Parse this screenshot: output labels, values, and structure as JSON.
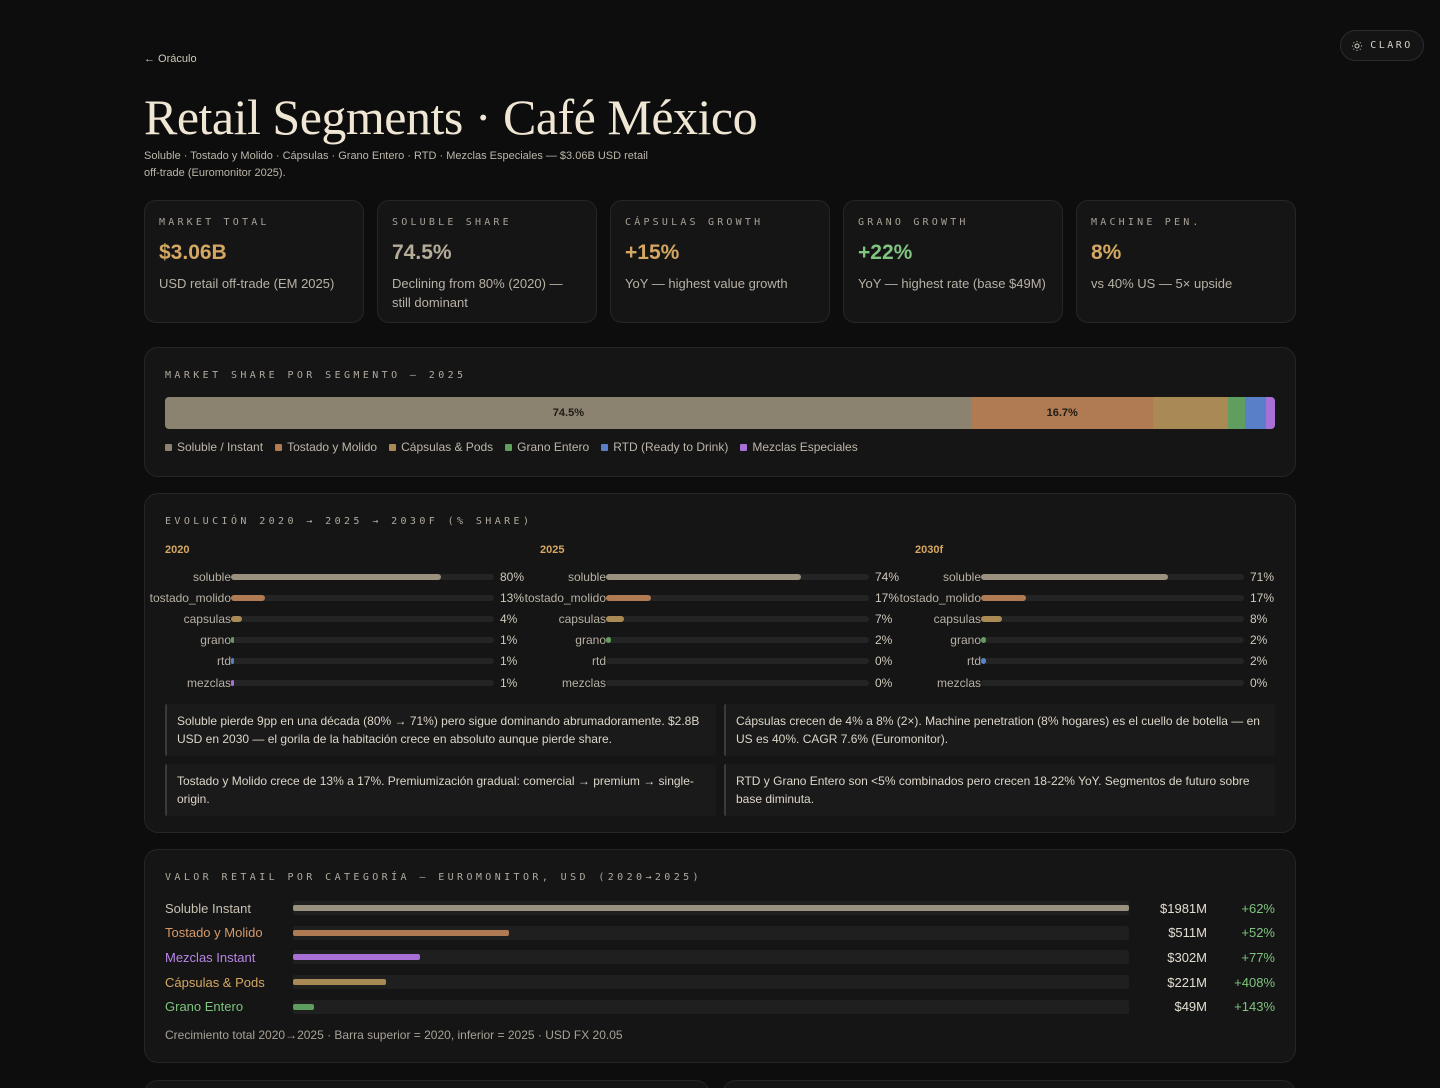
{
  "theme_toggle": {
    "label": "CLARO",
    "icon": "sun-icon"
  },
  "back_link": "← Oráculo",
  "title": "Retail Segments · Café México",
  "subtitle": "Soluble · Tostado y Molido · Cápsulas · Grano Entero · RTD · Mezclas Especiales — $3.06B USD retail off-trade (Euromonitor 2025).",
  "kpis": [
    {
      "label": "Market Total",
      "value": "$3.06B",
      "desc": "USD retail off-trade (EM 2025)",
      "color": "#d4a862"
    },
    {
      "label": "Soluble Share",
      "value": "74.5%",
      "desc": "Declining from 80% (2020) — still dominant",
      "color": "#b5ac9a"
    },
    {
      "label": "Cápsulas Growth",
      "value": "+15%",
      "desc": "YoY — highest value growth",
      "color": "#d4a862"
    },
    {
      "label": "Grano Growth",
      "value": "+22%",
      "desc": "YoY — highest rate (base $49M)",
      "color": "#7fc47f"
    },
    {
      "label": "Machine Pen.",
      "value": "8%",
      "desc": "vs 40% US — 5× upside",
      "color": "#d4a862"
    }
  ],
  "share": {
    "title": "Market Share por Segmento — 2025",
    "segments": [
      {
        "name": "Soluble / Instant",
        "value": 74.5,
        "label": "74.5%",
        "color": "#8b8370"
      },
      {
        "name": "Tostado y Molido",
        "value": 16.7,
        "label": "16.7%",
        "color": "#b07a52"
      },
      {
        "name": "Cápsulas & Pods",
        "value": 7.0,
        "label": "",
        "color": "#a98a55"
      },
      {
        "name": "Grano Entero",
        "value": 1.5,
        "label": "",
        "color": "#5f9e5f"
      },
      {
        "name": "RTD (Ready to Drink)",
        "value": 2.0,
        "label": "",
        "color": "#5a7fc9"
      },
      {
        "name": "Mezclas Especiales",
        "value": 0.8,
        "label": "",
        "color": "#a86fd6"
      }
    ]
  },
  "evolution": {
    "title": "Evolución 2020 → 2025 → 2030f (% share)",
    "columns": [
      {
        "year": "2020",
        "rows": [
          {
            "name": "soluble",
            "value": 80,
            "label": "80%"
          },
          {
            "name": "tostado_molido",
            "value": 13,
            "label": "13%"
          },
          {
            "name": "capsulas",
            "value": 4,
            "label": "4%"
          },
          {
            "name": "grano",
            "value": 1,
            "label": "1%"
          },
          {
            "name": "rtd",
            "value": 1,
            "label": "1%"
          },
          {
            "name": "mezclas",
            "value": 1,
            "label": "1%"
          }
        ]
      },
      {
        "year": "2025",
        "rows": [
          {
            "name": "soluble",
            "value": 74,
            "label": "74%"
          },
          {
            "name": "tostado_molido",
            "value": 17,
            "label": "17%"
          },
          {
            "name": "capsulas",
            "value": 7,
            "label": "7%"
          },
          {
            "name": "grano",
            "value": 2,
            "label": "2%"
          },
          {
            "name": "rtd",
            "value": 0,
            "label": "0%"
          },
          {
            "name": "mezclas",
            "value": 0,
            "label": "0%"
          }
        ]
      },
      {
        "year": "2030f",
        "rows": [
          {
            "name": "soluble",
            "value": 71,
            "label": "71%"
          },
          {
            "name": "tostado_molido",
            "value": 17,
            "label": "17%"
          },
          {
            "name": "capsulas",
            "value": 8,
            "label": "8%"
          },
          {
            "name": "grano",
            "value": 2,
            "label": "2%"
          },
          {
            "name": "rtd",
            "value": 2,
            "label": "2%"
          },
          {
            "name": "mezclas",
            "value": 0,
            "label": "0%"
          }
        ]
      }
    ],
    "row_colors": [
      "#9a927e",
      "#b07a52",
      "#a98a55",
      "#5f9e5f",
      "#5a7fc9",
      "#a86fd6"
    ],
    "notes": [
      "Soluble pierde 9pp en una década (80% → 71%) pero sigue dominando abrumadoramente. $2.8B USD en 2030 — el gorila de la habitación crece en absoluto aunque pierde share.",
      "Cápsulas crecen de 4% a 8% (2×). Machine penetration (8% hogares) es el cuello de botella — en US es 40%. CAGR 7.6% (Euromonitor).",
      "Tostado y Molido crece de 13% a 17%. Premiumización gradual: comercial → premium → single-origin.",
      "RTD y Grano Entero son <5% combinados pero crecen 18-22% YoY. Segmentos de futuro sobre base diminuta."
    ]
  },
  "retail_value": {
    "title": "Valor Retail por Categoría — Euromonitor, USD (2020→2025)",
    "rows": [
      {
        "name": "Soluble Instant",
        "value": 1981,
        "amount": "$1981M",
        "growth": "+62%",
        "color": "#9a927e",
        "label_color": "#c8c1b3"
      },
      {
        "name": "Tostado y Molido",
        "value": 511,
        "amount": "$511M",
        "growth": "+52%",
        "color": "#b07a52",
        "label_color": "#d49a6a"
      },
      {
        "name": "Mezclas Instant",
        "value": 302,
        "amount": "$302M",
        "growth": "+77%",
        "color": "#a86fd6",
        "label_color": "#b886e6"
      },
      {
        "name": "Cápsulas & Pods",
        "value": 221,
        "amount": "$221M",
        "growth": "+408%",
        "color": "#a98a55",
        "label_color": "#d4a862"
      },
      {
        "name": "Grano Entero",
        "value": 49,
        "amount": "$49M",
        "growth": "+143%",
        "color": "#5f9e5f",
        "label_color": "#7fc47f"
      }
    ],
    "max": 1981,
    "footnote": "Crecimiento total 2020→2025 · Barra superior = 2020, inferior = 2025 · USD FX 20.05"
  }
}
